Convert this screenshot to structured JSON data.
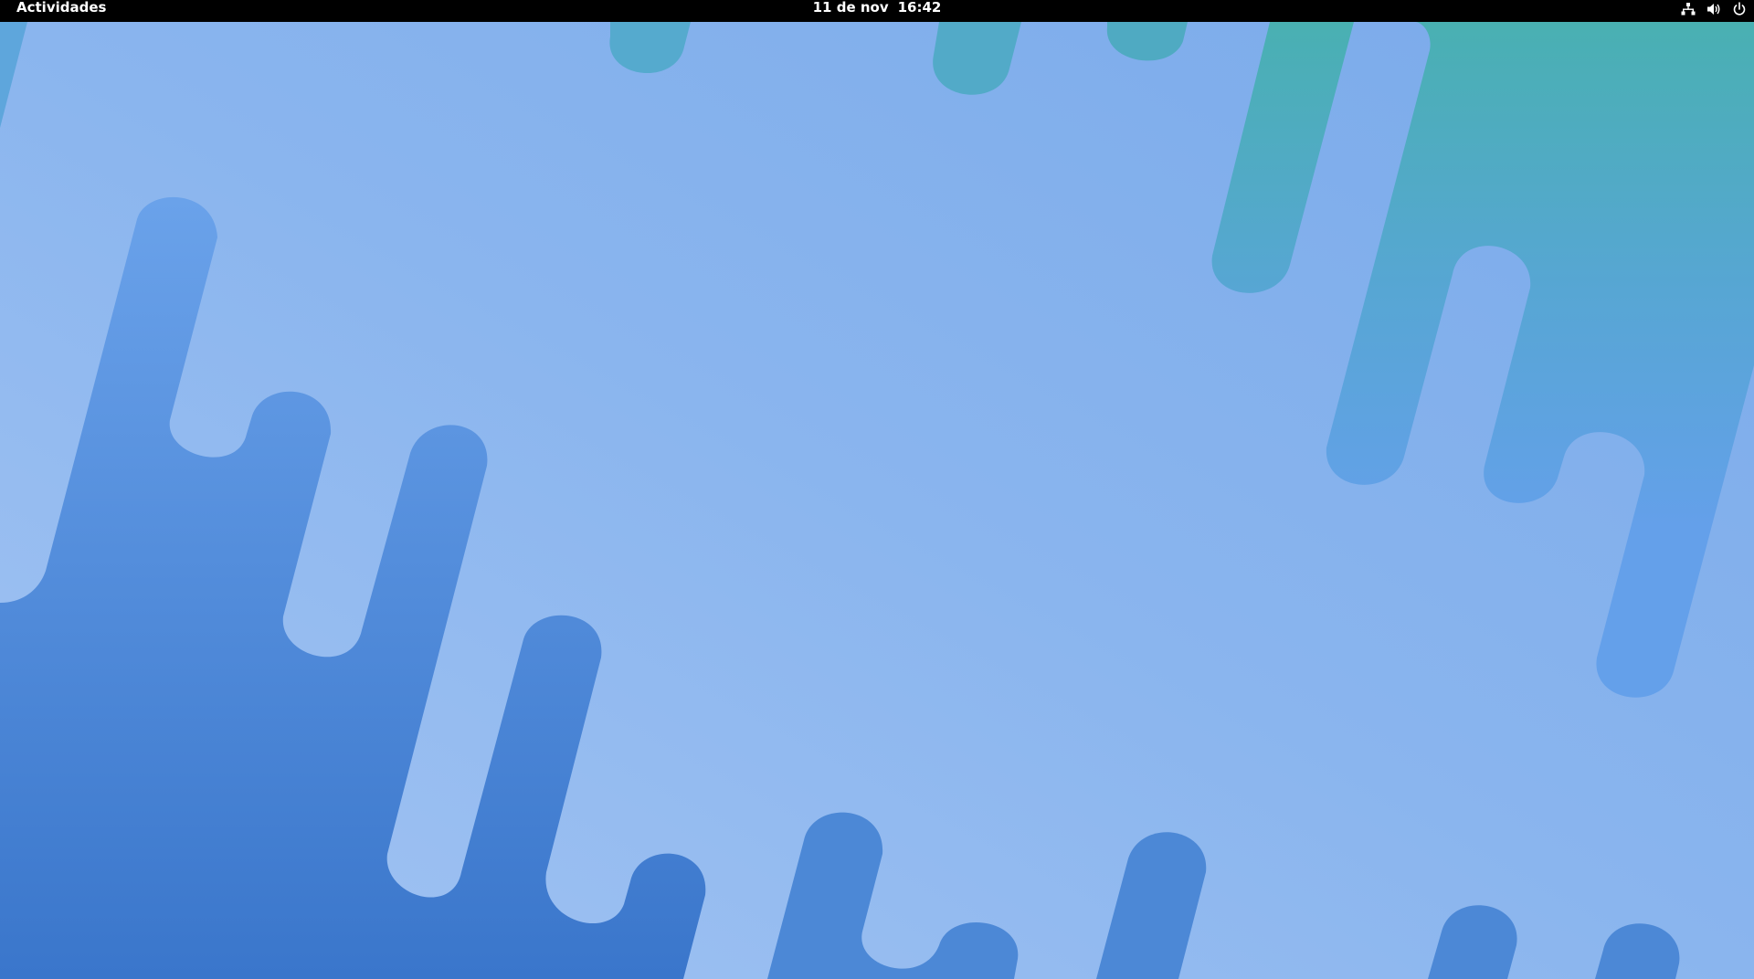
{
  "topbar": {
    "activities_label": "Actividades",
    "date": "11 de nov",
    "time": "16:42",
    "status_icons": [
      "network-wired-icon",
      "volume-icon",
      "power-icon"
    ]
  },
  "colors": {
    "topbar_bg": "#000000",
    "wallpaper_light": "#9cc0f2",
    "wallpaper_mid": "#6ea3ec",
    "wallpaper_deep": "#3a78cc",
    "wallpaper_teal": "#48b0b0"
  }
}
